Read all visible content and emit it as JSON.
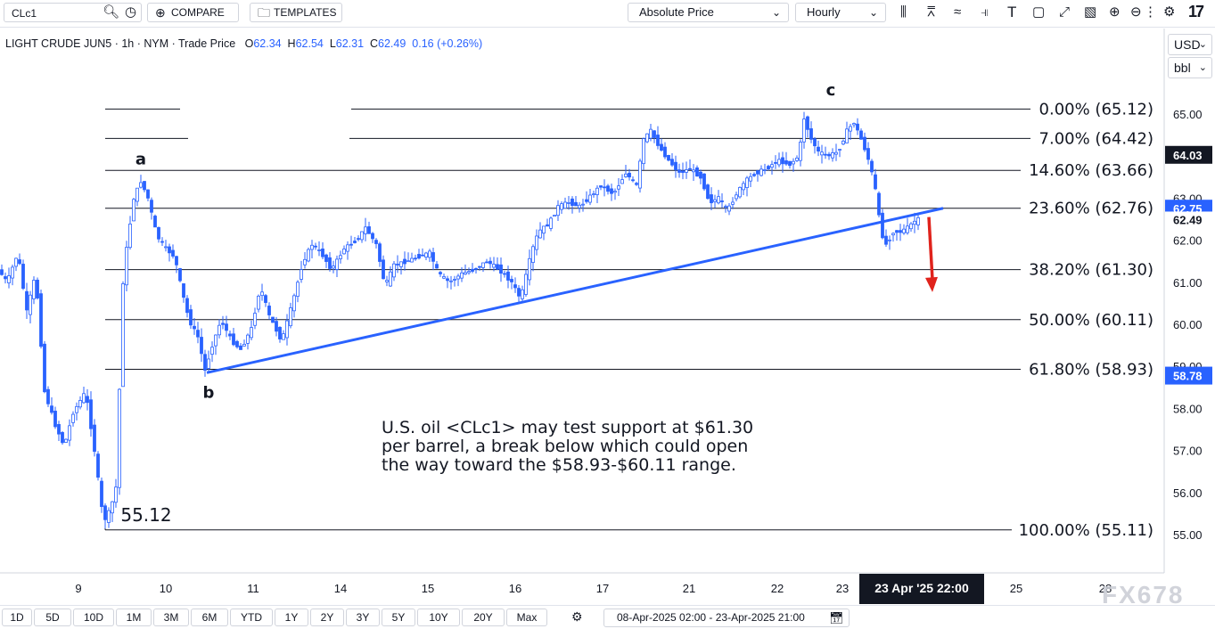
{
  "toolbar": {
    "symbol": "CLc1",
    "compare_label": "COMPARE",
    "templates_label": "TEMPLATES",
    "price_mode": "Absolute Price",
    "interval": "Hourly",
    "brand": "17"
  },
  "legend": {
    "instrument": "LIGHT CRUDE JUN5 · 1h · NYM · Trade Price",
    "open_label": "O",
    "open": "62.34",
    "high_label": "H",
    "high": "62.54",
    "low_label": "L",
    "low": "62.31",
    "close_label": "C",
    "close": "62.49",
    "change": "0.16 (+0.26%)"
  },
  "axis_controls": {
    "currency": "USD",
    "unit": "bbl"
  },
  "colors": {
    "up": "#2962ff",
    "down": "#2962ff",
    "trendline": "#2962ff",
    "fib": "#131722",
    "arrow": "#e0231c",
    "badge_dark": "#131722",
    "badge_blue": "#2962ff",
    "accent": "#2962ff"
  },
  "chart_data": {
    "type": "candlestick",
    "ylim": [
      54.2,
      66.3
    ],
    "yticks": [
      55,
      56,
      57,
      58,
      59,
      60,
      61,
      62,
      63,
      64,
      65
    ],
    "yticks_labels": [
      "55.00",
      "56.00",
      "57.00",
      "58.00",
      "59.00",
      "60.00",
      "61.00",
      "62.00",
      "63.00",
      "64.00",
      "65.00"
    ],
    "x_tick_labels": [
      "9",
      "10",
      "11",
      "14",
      "15",
      "16",
      "17",
      "21",
      "22",
      "23",
      "25",
      "28"
    ],
    "x_range": [
      "2025-04-08 02:00",
      "2025-04-23 21:00"
    ],
    "price_path": [
      [
        0,
        61.3
      ],
      [
        10,
        61.0
      ],
      [
        22,
        61.7
      ],
      [
        32,
        60.3
      ],
      [
        42,
        61.2
      ],
      [
        52,
        58.4
      ],
      [
        64,
        57.6
      ],
      [
        74,
        57.1
      ],
      [
        84,
        57.9
      ],
      [
        98,
        58.4
      ],
      [
        108,
        57.0
      ],
      [
        118,
        55.3
      ],
      [
        126,
        55.6
      ],
      [
        134,
        56.3
      ],
      [
        138,
        60.6
      ],
      [
        144,
        61.8
      ],
      [
        152,
        63.0
      ],
      [
        160,
        63.4
      ],
      [
        168,
        63.0
      ],
      [
        178,
        62.1
      ],
      [
        188,
        61.8
      ],
      [
        198,
        61.6
      ],
      [
        206,
        60.8
      ],
      [
        214,
        60.1
      ],
      [
        224,
        59.7
      ],
      [
        232,
        58.9
      ],
      [
        240,
        59.5
      ],
      [
        250,
        60.1
      ],
      [
        262,
        59.6
      ],
      [
        272,
        59.4
      ],
      [
        284,
        59.9
      ],
      [
        294,
        60.9
      ],
      [
        304,
        60.2
      ],
      [
        318,
        59.6
      ],
      [
        330,
        60.5
      ],
      [
        342,
        61.5
      ],
      [
        352,
        61.9
      ],
      [
        362,
        61.7
      ],
      [
        374,
        61.3
      ],
      [
        388,
        61.8
      ],
      [
        402,
        62.0
      ],
      [
        412,
        62.3
      ],
      [
        424,
        61.9
      ],
      [
        434,
        60.9
      ],
      [
        444,
        61.4
      ],
      [
        458,
        61.5
      ],
      [
        470,
        61.6
      ],
      [
        484,
        61.7
      ],
      [
        494,
        61.2
      ],
      [
        506,
        61.0
      ],
      [
        520,
        61.2
      ],
      [
        534,
        61.3
      ],
      [
        548,
        61.5
      ],
      [
        562,
        61.3
      ],
      [
        576,
        61.0
      ],
      [
        586,
        60.6
      ],
      [
        598,
        61.7
      ],
      [
        606,
        62.2
      ],
      [
        618,
        62.4
      ],
      [
        628,
        62.8
      ],
      [
        640,
        62.9
      ],
      [
        652,
        62.8
      ],
      [
        662,
        63.0
      ],
      [
        676,
        63.3
      ],
      [
        690,
        63.1
      ],
      [
        704,
        63.6
      ],
      [
        716,
        63.3
      ],
      [
        724,
        64.4
      ],
      [
        732,
        64.6
      ],
      [
        742,
        64.2
      ],
      [
        752,
        63.9
      ],
      [
        764,
        63.6
      ],
      [
        776,
        63.7
      ],
      [
        788,
        63.5
      ],
      [
        798,
        62.9
      ],
      [
        808,
        63.0
      ],
      [
        818,
        62.7
      ],
      [
        828,
        63.1
      ],
      [
        838,
        63.4
      ],
      [
        850,
        63.6
      ],
      [
        862,
        63.7
      ],
      [
        874,
        63.9
      ],
      [
        888,
        63.8
      ],
      [
        898,
        64.0
      ],
      [
        904,
        64.9
      ],
      [
        912,
        64.4
      ],
      [
        920,
        64.1
      ],
      [
        930,
        64.0
      ],
      [
        942,
        64.1
      ],
      [
        952,
        64.6
      ],
      [
        960,
        64.8
      ],
      [
        970,
        64.3
      ],
      [
        978,
        63.8
      ],
      [
        985,
        63.1
      ],
      [
        990,
        62.2
      ],
      [
        996,
        61.9
      ],
      [
        1004,
        62.2
      ],
      [
        1012,
        62.2
      ],
      [
        1020,
        62.3
      ],
      [
        1030,
        62.49
      ]
    ],
    "fib_levels": [
      {
        "label": "0.00% (65.12)",
        "value": 65.12
      },
      {
        "label": "7.00% (64.42)",
        "value": 64.42
      },
      {
        "label": "14.60% (63.66)",
        "value": 63.66
      },
      {
        "label": "23.60% (62.76)",
        "value": 62.76
      },
      {
        "label": "38.20% (61.30)",
        "value": 61.3
      },
      {
        "label": "50.00% (60.11)",
        "value": 60.11
      },
      {
        "label": "61.80% (58.93)",
        "value": 58.93
      },
      {
        "label": "100.00% (55.11)",
        "value": 55.11
      }
    ],
    "trendline": {
      "from": [
        232,
        58.85
      ],
      "to": [
        1058,
        62.76
      ]
    },
    "wave_labels": [
      {
        "text": "a",
        "x": 158,
        "y": 63.8
      },
      {
        "text": "b",
        "x": 234,
        "y": 58.25
      },
      {
        "text": "c",
        "x": 932,
        "y": 65.45
      },
      {
        "text": "55.12",
        "x": 164,
        "y": 55.32
      }
    ],
    "price_badges": [
      {
        "text": "64.03",
        "value": 64.03,
        "style": "dark"
      },
      {
        "text": "62.75",
        "value": 62.75,
        "style": "blue"
      },
      {
        "text": "62.49",
        "value": 62.49,
        "style": "plain"
      },
      {
        "text": "58.78",
        "value": 58.78,
        "style": "blue"
      }
    ],
    "annotation": [
      "U.S. oil <CLc1> may test support at $61.30",
      "per barrel, a break below which could open",
      "the way toward the $58.93-$60.11 range."
    ],
    "crosshair_label": "23 Apr '25   22:00"
  },
  "bottom": {
    "ranges": [
      "1D",
      "5D",
      "10D",
      "1M",
      "3M",
      "6M",
      "YTD",
      "1Y",
      "2Y",
      "3Y",
      "5Y",
      "10Y",
      "20Y",
      "Max"
    ],
    "date_range": "08-Apr-2025 02:00  -  23-Apr-2025 21:00",
    "watermark": "FX678"
  }
}
